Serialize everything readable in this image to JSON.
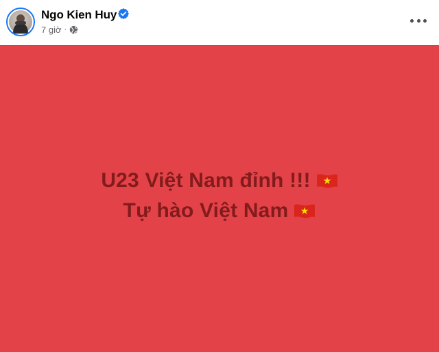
{
  "post": {
    "author": "Ngo Kien Huy",
    "time": "7 giờ",
    "separator": "·",
    "privacy_icon": "globe-icon",
    "verified_icon": "verified-badge-icon",
    "menu_icon": "more-options-icon",
    "lines": [
      "U23 Việt Nam đỉnh !!!",
      "Tự hào Việt Nam"
    ]
  },
  "colors": {
    "background": "#e34248",
    "text": "#821b1c",
    "verified": "#1877f2",
    "meta": "#65676b"
  }
}
